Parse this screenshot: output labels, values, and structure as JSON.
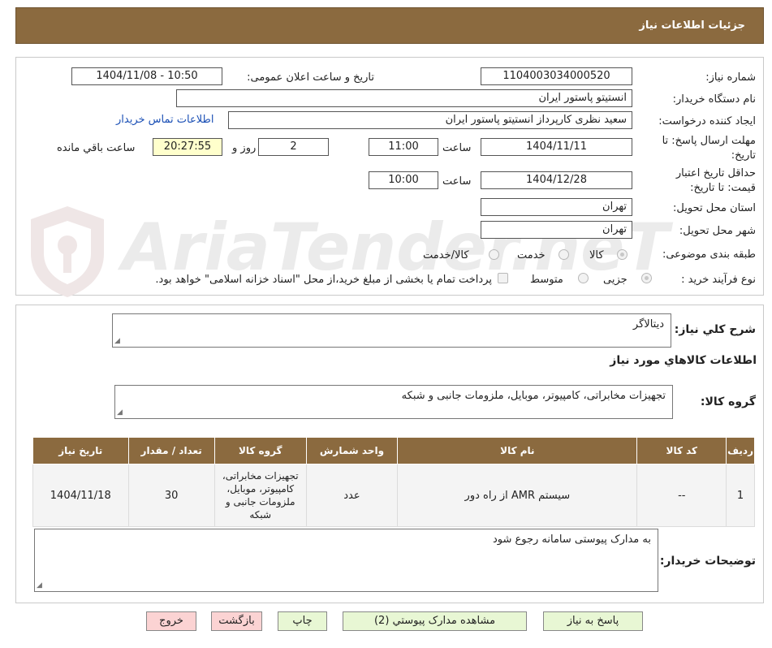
{
  "header": {
    "title": "جزئیات اطلاعات نیاز"
  },
  "watermark": {
    "text": "AriaTender.neT"
  },
  "form": {
    "need_number_label": "شماره نیاز:",
    "need_number": "1104003034000520",
    "announce_label": "تاریخ و ساعت اعلان عمومی:",
    "announce_value": "1404/11/08 - 10:50",
    "buyer_org_label": "نام دستگاه خریدار:",
    "buyer_org": "انستیتو پاستور ایران",
    "creator_label": "ایجاد کننده درخواست:",
    "creator": "سعید نظری کارپرداز انستیتو پاستور ایران",
    "contact_link": "اطلاعات تماس خریدار",
    "reply_deadline_label_1": "مهلت ارسال پاسخ: تا",
    "reply_deadline_label_2": "تاریخ:",
    "reply_date": "1404/11/11",
    "time_label": "ساعت",
    "reply_time": "11:00",
    "days_value": "2",
    "days_label": "روز و",
    "remaining_time": "20:27:55",
    "remaining_label": "ساعت باقي مانده",
    "validity_label_1": "حداقل تاریخ اعتبار",
    "validity_label_2": "قیمت: تا تاریخ:",
    "validity_date": "1404/12/28",
    "validity_time": "10:00",
    "province_label": "استان محل تحویل:",
    "province": "تهران",
    "city_label": "شهر محل تحویل:",
    "city": "تهران",
    "category_label": "طبقه بندی موضوعی:",
    "category_options": [
      "کالا",
      "خدمت",
      "کالا/خدمت"
    ],
    "category_selected": "کالا",
    "process_label": "نوع فرآیند خرید :",
    "process_options": [
      "جزیی",
      "متوسط"
    ],
    "process_selected": "جزیی",
    "treasury_text": "پرداخت تمام یا بخشی از مبلغ خرید،از محل \"اسناد خزانه اسلامی\" خواهد بود."
  },
  "details": {
    "summary_label": "شرح کلي نياز:",
    "summary_value": "دیتالاگر",
    "goods_info_title": "اطلاعات کالاهاي مورد نياز",
    "goods_group_label": "گروه کالا:",
    "goods_group_value": "تجهیزات مخابراتی، کامپیوتر، موبایل، ملزومات جانبی و شبکه",
    "table": {
      "headers": [
        "رديف",
        "کد کالا",
        "نام کالا",
        "واحد شمارش",
        "گروه کالا",
        "تعداد / مقدار",
        "تاريخ نياز"
      ],
      "rows": [
        [
          "1",
          "--",
          "سیستم AMR از راه دور",
          "عدد",
          "تجهیزات مخابراتی، کامپیوتر، موبایل، ملزومات جانبی و شبکه",
          "30",
          "1404/11/18"
        ]
      ]
    },
    "buyer_notes_label": "توضیحات خریدار:",
    "buyer_notes_value": "به مدارک پیوستی سامانه رجوع شود"
  },
  "buttons": {
    "reply": "پاسخ به نیاز",
    "attachments": "مشاهده مدارک پیوستي (2)",
    "print": "چاپ",
    "back": "بازگشت",
    "exit": "خروج"
  },
  "colors": {
    "header_bg": "#8b6a3f",
    "highlight_bg": "#ffffcc",
    "green_button": "#e8f7d4",
    "pink_button": "#fbd3d3",
    "link": "#1a4fb5"
  }
}
